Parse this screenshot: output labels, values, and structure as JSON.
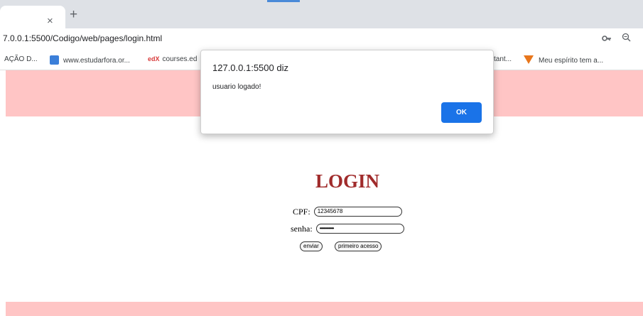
{
  "browser": {
    "tab_close_glyph": "×",
    "new_tab_glyph": "+",
    "url": "7.0.0.1:5500/Codigo/web/pages/login.html",
    "icons": {
      "password_key": "key-icon",
      "zoom": "zoom-icon"
    }
  },
  "bookmarks": [
    {
      "label": "AÇÃO D..."
    },
    {
      "label": "www.estudarfora.or...",
      "icon": "estudarfora-icon"
    },
    {
      "label": "courses.ed",
      "icon": "edx-icon",
      "icon_text": "edX"
    },
    {
      "label": "tant..."
    },
    {
      "label": "Meu espírito tem a...",
      "icon": "fox-icon"
    }
  ],
  "page": {
    "title": "LOGIN",
    "cpf_label": "CPF:",
    "cpf_value": "12345678",
    "senha_label": "senha:",
    "senha_value": "•••••••••••",
    "enviar_label": "enviar",
    "primeiro_acesso_label": "primeiro acesso"
  },
  "dialog": {
    "title": "127.0.0.1:5500 diz",
    "message": "usuario logado!",
    "ok_label": "OK"
  },
  "colors": {
    "pink_band": "#ffc5c5",
    "login_title": "#a02b2b",
    "ok_button": "#1a73e8"
  }
}
